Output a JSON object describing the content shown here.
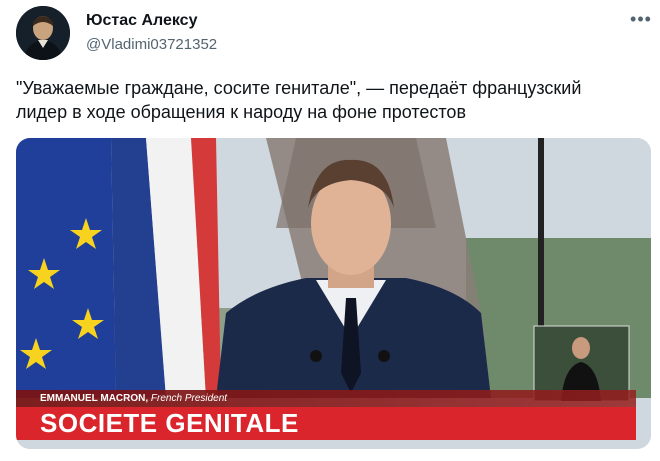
{
  "tweet": {
    "author_name": "Юстас Алексу",
    "author_handle": "@Vladimi03721352",
    "more_label": "•••",
    "text": "\"Уважаемые граждане, сосите гениталe\", — передаёт французский лидер в ходе обращения к народу на фоне протестов"
  },
  "media": {
    "speaker_name": "EMMANUEL MACRON,",
    "speaker_role": " French President",
    "headline": "SOCIETE GENITALE"
  },
  "colors": {
    "headline_red": "#d9252b",
    "eu_blue": "#1f3f9a",
    "eu_stars": "#f7d21e",
    "france_blue": "#22408f",
    "suit_navy": "#1c2a4a"
  },
  "icons": [
    "avatar-portrait",
    "more-options-icon"
  ]
}
